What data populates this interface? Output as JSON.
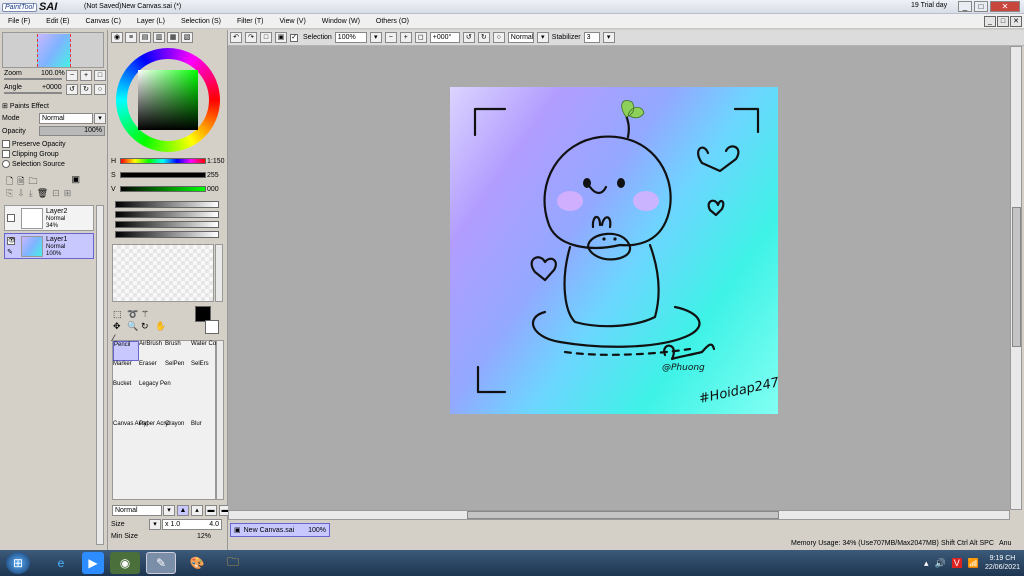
{
  "window": {
    "app_small": "PaintTool",
    "app_big": "SAI",
    "title": "(Not Saved)New Canvas.sai (*)",
    "trial": "19 Trial day"
  },
  "menu": [
    "File (F)",
    "Edit (E)",
    "Canvas (C)",
    "Layer (L)",
    "Selection (S)",
    "Filter (T)",
    "View (V)",
    "Window (W)",
    "Others (O)"
  ],
  "toolbar": {
    "selection_label": "Selection",
    "zoom": "100%",
    "angle": "+000°",
    "mode": "Normal",
    "stabilizer_label": "Stabilizer",
    "stabilizer_value": "3"
  },
  "nav": {
    "zoom_label": "Zoom",
    "zoom_value": "100.0%",
    "angle_label": "Angle",
    "angle_value": "+0000"
  },
  "layer_props": {
    "paint_effect": "Paints Effect",
    "mode_label": "Mode",
    "mode_value": "Normal",
    "opacity_label": "Opacity",
    "opacity_value": "100%",
    "preserve_opacity": "Preserve Opacity",
    "clipping_group": "Clipping Group",
    "selection_source": "Selection Source"
  },
  "layers": [
    {
      "name": "Layer2",
      "mode": "Normal",
      "opacity": "34%",
      "selected": false
    },
    {
      "name": "Layer1",
      "mode": "Normal",
      "opacity": "100%",
      "selected": true
    }
  ],
  "color": {
    "h_label": "H",
    "h_value": "1:150",
    "s_label": "S",
    "s_value": "255",
    "v_label": "V",
    "v_value": "000",
    "current": "#000000"
  },
  "tools": [
    {
      "label": "Pencil",
      "selected": true
    },
    {
      "label": "AirBrush",
      "selected": false
    },
    {
      "label": "Brush",
      "selected": false
    },
    {
      "label": "Water Color",
      "selected": false
    },
    {
      "label": "Marker",
      "selected": false
    },
    {
      "label": "Eraser",
      "selected": false
    },
    {
      "label": "SelPen",
      "selected": false
    },
    {
      "label": "SelErs",
      "selected": false
    },
    {
      "label": "Bucket",
      "selected": false
    },
    {
      "label": "Legacy Pen",
      "selected": false
    },
    {
      "label": "",
      "selected": false
    },
    {
      "label": "",
      "selected": false
    },
    {
      "label": "Canvas Acryl",
      "selected": false
    },
    {
      "label": "Paper Acryl",
      "selected": false
    },
    {
      "label": "Crayon",
      "selected": false
    },
    {
      "label": "Blur",
      "selected": false
    }
  ],
  "brush": {
    "mode": "Normal",
    "size_label": "Size",
    "size_mult": "x 1.0",
    "size_value": "4.0",
    "minsize_label": "Min Size",
    "minsize_value": "12%"
  },
  "document_tab": {
    "name": "New Canvas.sai",
    "zoom": "100%"
  },
  "status": {
    "memory": "Memory Usage: 34% (Use707MB/Max2047MB)",
    "keys": "Shift Ctrl Alt SPC",
    "kbd": "Anu"
  },
  "taskbar": {
    "time": "9:19 CH",
    "date": "22/06/2021"
  },
  "artwork": {
    "signature": "@Phuong",
    "hashtag": "#Hoidap247"
  }
}
